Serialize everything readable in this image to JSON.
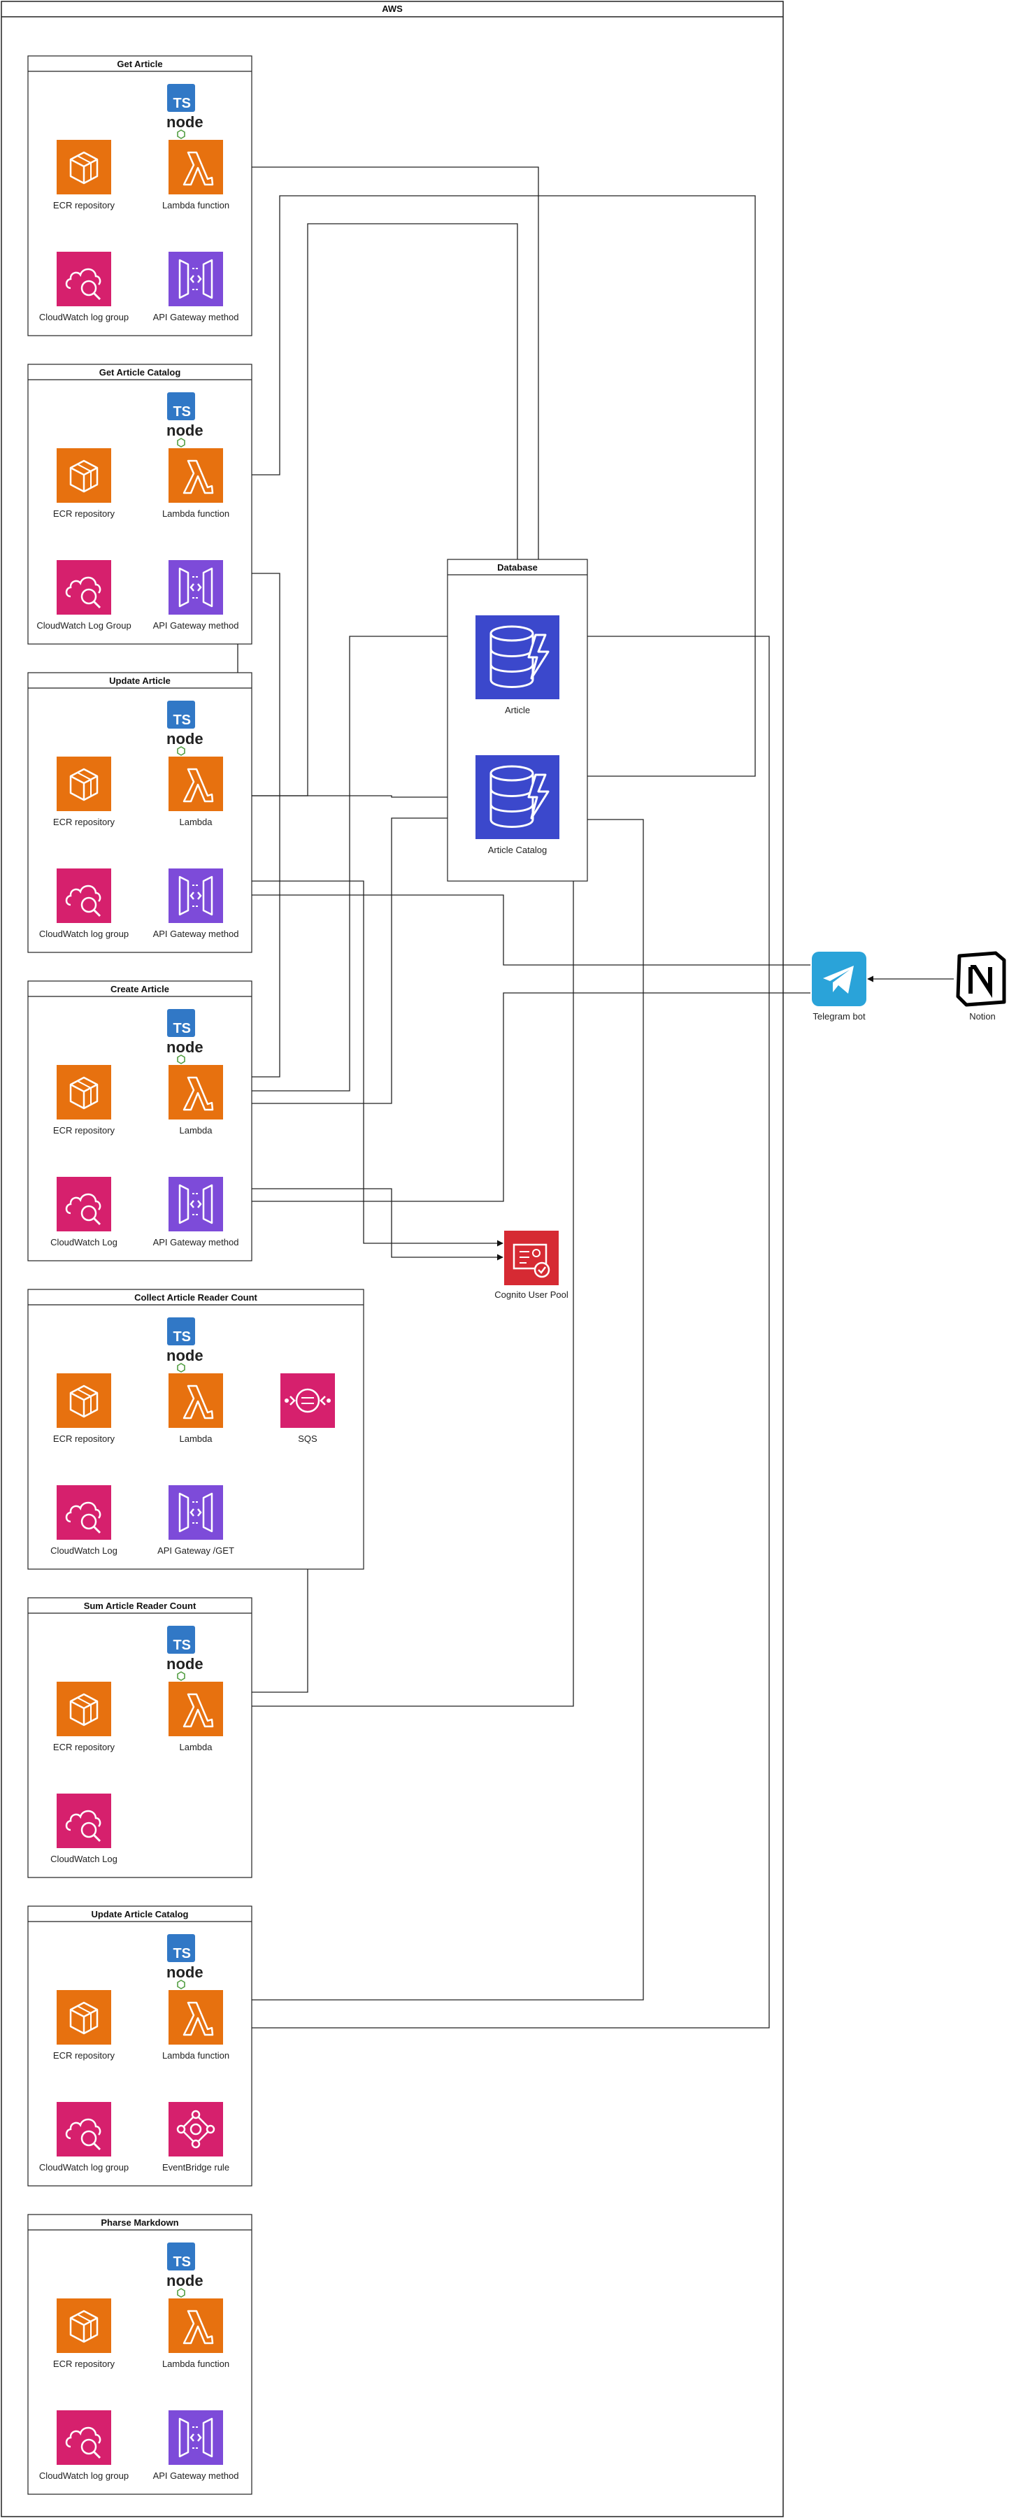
{
  "aws_title": "AWS",
  "colors": {
    "lambda": "#E7710F",
    "ecr": "#E7710F",
    "cloudwatch": "#D6206D",
    "apigateway": "#7D4BD9",
    "dynamodb": "#3B48CC",
    "cognito": "#D62A33",
    "telegram": "#2AA3D9",
    "typescript": "#3178C6",
    "node_green": "#539E43"
  },
  "groups": [
    {
      "title": "Get Article",
      "ecr": "ECR repository",
      "lambda": "Lambda function",
      "log": "CloudWatch log group",
      "bottom": "API Gateway method",
      "bottom_type": "api"
    },
    {
      "title": "Get Article Catalog",
      "ecr": "ECR repository",
      "lambda": "Lambda function",
      "log": "CloudWatch Log Group",
      "bottom": "API Gateway method",
      "bottom_type": "api"
    },
    {
      "title": "Update Article",
      "ecr": "ECR repository",
      "lambda": "Lambda",
      "log": "CloudWatch log group",
      "bottom": "API Gateway method",
      "bottom_type": "api"
    },
    {
      "title": "Create Article",
      "ecr": "ECR repository",
      "lambda": "Lambda",
      "log": "CloudWatch Log",
      "bottom": "API Gateway method",
      "bottom_type": "api"
    },
    {
      "title": "Collect Article Reader Count",
      "ecr": "ECR repository",
      "lambda": "Lambda",
      "log": "CloudWatch Log",
      "bottom": "API Gateway /GET",
      "bottom_type": "api",
      "extra": "SQS"
    },
    {
      "title": "Sum Article Reader Count",
      "ecr": "ECR repository",
      "lambda": "Lambda",
      "log": "CloudWatch Log",
      "bottom": "",
      "bottom_type": "none"
    },
    {
      "title": "Update Article Catalog",
      "ecr": "ECR repository",
      "lambda": "Lambda function",
      "log": "CloudWatch log group",
      "bottom": "EventBridge rule",
      "bottom_type": "eventbridge"
    },
    {
      "title": "Pharse Markdown",
      "ecr": "ECR repository",
      "lambda": "Lambda function",
      "log": "CloudWatch log group",
      "bottom": "API Gateway method",
      "bottom_type": "api"
    }
  ],
  "database": {
    "title": "Database",
    "tables": [
      "Article",
      "Article Catalog"
    ]
  },
  "cognito_label": "Cognito User Pool",
  "telegram_label": "Telegram bot",
  "notion_label": "Notion"
}
